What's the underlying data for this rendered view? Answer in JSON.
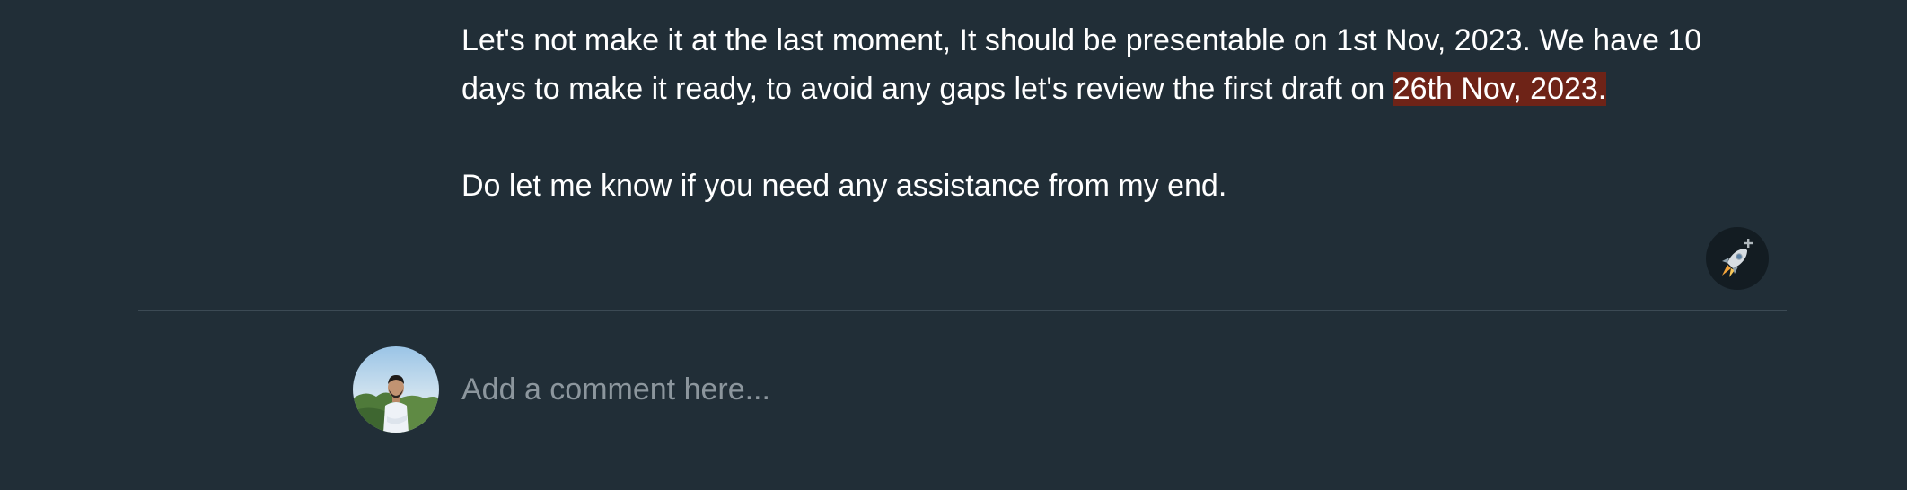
{
  "message": {
    "line1_text": "Let's not make it at the last moment, It should be presentable on 1st Nov, 2023. We have 10 days to make it ready, to avoid any gaps let's review the first draft on ",
    "highlighted_date": "26th Nov, 2023.",
    "line2_text": "Do let me know if you need any assistance from my end."
  },
  "reaction": {
    "icon": "rocket-add-reaction-icon"
  },
  "comment": {
    "placeholder": "Add a comment here...",
    "value": ""
  },
  "colors": {
    "background": "#212e37",
    "highlight": "#6e2317",
    "divider": "#3c4a54",
    "placeholder": "#8c969d"
  }
}
